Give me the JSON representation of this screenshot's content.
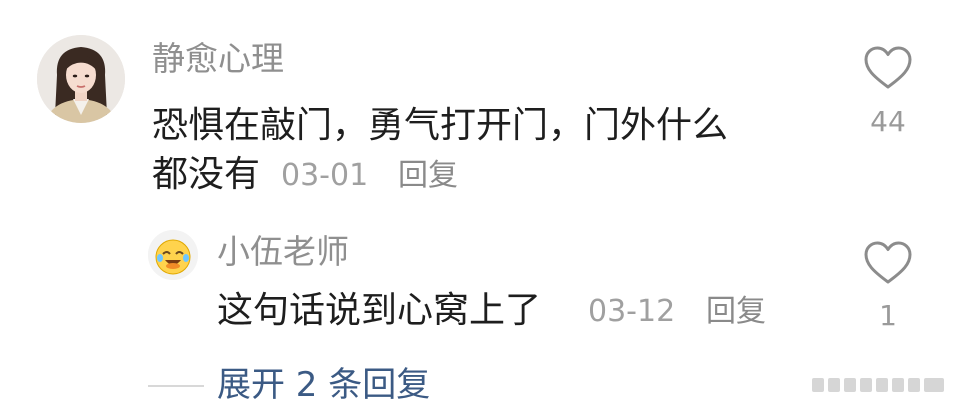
{
  "comment": {
    "username": "静愈心理",
    "text_line1": "恐惧在敲门，勇气打开门，门外什么",
    "text_line2": "都没有",
    "date": "03-01",
    "reply_label": "回复",
    "like_count": "44"
  },
  "reply": {
    "username": "小伍老师",
    "text": "这句话说到心窝上了",
    "date": "03-12",
    "reply_label": "回复",
    "like_count": "1"
  },
  "expand": {
    "label": "展开 2 条回复"
  },
  "icons": {
    "like": "heart-outline-icon",
    "avatar_reply": "emoji-avatar"
  },
  "colors": {
    "username": "#8f8f8f",
    "text": "#1e1e1e",
    "meta": "#a0a0a0",
    "link": "#3b5a84",
    "icon": "#8c8c8c"
  }
}
